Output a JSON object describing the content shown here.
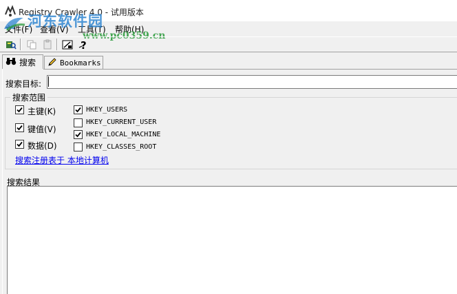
{
  "window": {
    "title": "Registry Crawler 4.0 - 试用版本"
  },
  "watermark": {
    "title": "河东软件园",
    "url": "www.pc0359.cn"
  },
  "menu": {
    "file": "文件(F)",
    "view": "查看(V)",
    "tools": "工具(T)",
    "help": "帮助(H)"
  },
  "toolbar": {
    "icons": [
      "search-db-icon",
      "copy-icon",
      "paste-icon",
      "window-icon",
      "help-icon"
    ]
  },
  "tabs": {
    "search": "搜索",
    "bookmarks": "Bookmarks"
  },
  "search": {
    "target_label": "搜索目标:",
    "target_value": ""
  },
  "scope": {
    "legend": "搜索范围",
    "options": [
      {
        "label": "主键(K)",
        "checked": true
      },
      {
        "label": "键值(V)",
        "checked": true
      },
      {
        "label": "数据(D)",
        "checked": true
      }
    ],
    "hives": [
      {
        "label": "HKEY_USERS",
        "checked": true
      },
      {
        "label": "HKEY_CURRENT_USER",
        "checked": false
      },
      {
        "label": "HKEY_LOCAL_MACHINE",
        "checked": true
      },
      {
        "label": "HKEY_CLASSES_ROOT",
        "checked": false
      }
    ],
    "link": "搜索注册表于 本地计算机"
  },
  "results": {
    "label": "搜索结果"
  },
  "colors": {
    "link": "#0000ee",
    "watermark_blue": "#2f86d1",
    "watermark_green": "#2a9a3a"
  }
}
